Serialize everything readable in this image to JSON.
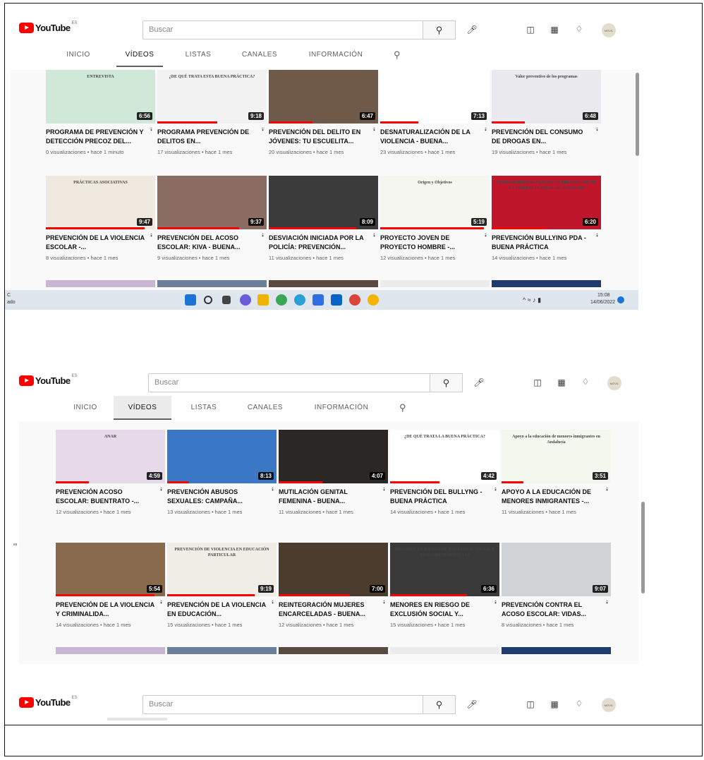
{
  "header": {
    "logo_text": "YouTube",
    "region": "ES",
    "search_placeholder": "Buscar",
    "avatar_text": "MÓVIL"
  },
  "tabs": [
    {
      "label": "INICIO"
    },
    {
      "label": "VÍDEOS"
    },
    {
      "label": "LISTAS"
    },
    {
      "label": "CANALES"
    },
    {
      "label": "INFORMACIÓN"
    }
  ],
  "shot1": {
    "videos": [
      {
        "title": "PROGRAMA DE PREVENCIÓN Y DETECCIÓN PRECOZ DEL...",
        "meta": "0 visualizaciones • hace 1 minuto",
        "duration": "6:56",
        "thumb_text": "ENTREVISTA",
        "bg": "#cfe8d8",
        "progress": 0
      },
      {
        "title": "PROGRAMA PREVENCIÓN DE DELITOS EN...",
        "meta": "17 visualizaciones • hace 1 mes",
        "duration": "9:18",
        "thumb_text": "¿DE QUÉ TRATA ESTA BUENA PRÁCTICA?",
        "bg": "#f2f2f2",
        "progress": 0.55
      },
      {
        "title": "PREVENCIÓN DEL DELITO EN JÓVENES: TU ESCUELITA...",
        "meta": "20 visualizaciones • hace 1 mes",
        "duration": "6:47",
        "thumb_text": "",
        "bg": "#6f5a4a",
        "progress": 0.4
      },
      {
        "title": "DESNATURALIZACIÓN DE LA VIOLENCIA - BUENA...",
        "meta": "23 visualizaciones • hace 1 mes",
        "duration": "7:13",
        "thumb_text": "",
        "bg": "#ffffff",
        "progress": 0.35
      },
      {
        "title": "PREVENCIÓN DEL CONSUMO DE DROGAS EN...",
        "meta": "19 visualizaciones • hace 1 mes",
        "duration": "6:48",
        "thumb_text": "Valor preventivo de los programas",
        "bg": "#e9e9ee",
        "progress": 0.3
      },
      {
        "title": "PREVENCIÓN DE LA VIOLENCIA ESCOLAR -...",
        "meta": "8 visualizaciones • hace 1 mes",
        "duration": "9:47",
        "thumb_text": "PRÁCTICAS ASOCIATIVAS",
        "bg": "#efe9df",
        "progress": 0.9
      },
      {
        "title": "PREVENCIÓN DEL ACOSO ESCOLAR: KIVA - BUENA...",
        "meta": "9 visualizaciones • hace 1 mes",
        "duration": "9:37",
        "thumb_text": "",
        "bg": "#8a6d60",
        "progress": 0.75
      },
      {
        "title": "DESVIACIÓN INICIADA POR LA POLICÍA: PREVENCIÓN...",
        "meta": "11 visualizaciones • hace 1 mes",
        "duration": "8:09",
        "thumb_text": "",
        "bg": "#3b3b3b",
        "progress": 0.8
      },
      {
        "title": "PROYECTO JOVEN DE PROYECTO HOMBRE -...",
        "meta": "12 visualizaciones • hace 1 mes",
        "duration": "5:19",
        "thumb_text": "Origen y Objetivos",
        "bg": "#f6f6f0",
        "progress": 0.95
      },
      {
        "title": "PREVENCIÓN BULLYING PDA - BUENA PRÁCTICA",
        "meta": "14 visualizaciones • hace 1 mes",
        "duration": "6:20",
        "thumb_text": "TRABAJO BUENAS PRÁCTICAS PREVENCIÓN DE LA VIOLENCIA ESCOLAR BULLYING",
        "bg": "#c0162c",
        "progress": 0.5
      }
    ],
    "taskbar": {
      "time": "15:08",
      "date": "14/06/2022",
      "left_text": "ado"
    }
  },
  "shot2": {
    "videos": [
      {
        "title": "PREVENCIÓN ACOSO ESCOLAR: BUENTRATO -...",
        "meta": "12 visualizaciones • hace 1 mes",
        "duration": "4:59",
        "thumb_text": "ANAR",
        "bg": "#e8d9ea",
        "progress": 0.3
      },
      {
        "title": "PREVENCIÓN ABUSOS SEXUALES: CAMPAÑA...",
        "meta": "13 visualizaciones • hace 1 mes",
        "duration": "8:13",
        "thumb_text": "",
        "bg": "#3a77c4",
        "progress": 0.2
      },
      {
        "title": "MUTILACIÓN GENITAL FEMENINA - BUENA...",
        "meta": "11 visualizaciones • hace 1 mes",
        "duration": "4:07",
        "thumb_text": "",
        "bg": "#2a2724",
        "progress": 0.4
      },
      {
        "title": "PREVENCIÓN DEL BULLYNG - BUENA PRÁCTICA",
        "meta": "14 visualizaciones • hace 1 mes",
        "duration": "4:42",
        "thumb_text": "¿DE QUÉ TRATA LA BUENA PRÁCTICA?",
        "bg": "#ffffff",
        "progress": 0.45
      },
      {
        "title": "APOYO A LA EDUCACIÓN DE MENORES INMIGRANTES -...",
        "meta": "11 visualizaciones • hace 1 mes",
        "duration": "3:51",
        "thumb_text": "Apoyo a la educación de menores inmigrantes en Andalucía",
        "bg": "#f4f7ee",
        "progress": 0.2
      },
      {
        "title": "PREVENCIÓN DE LA VIOLENCIA Y CRIMINALIDA...",
        "meta": "14 visualizaciones • hace 1 mes",
        "duration": "5:54",
        "thumb_text": "",
        "bg": "#8a6a4c",
        "progress": 0.9
      },
      {
        "title": "PREVENCIÓN DE LA VIOLENCIA EN EDUCACIÓN...",
        "meta": "15 visualizaciones • hace 1 mes",
        "duration": "9:19",
        "thumb_text": "PREVENCIÓN DE VIOLENCIA EN EDUCACIÓN PARTICULAR",
        "bg": "#f0ede6",
        "progress": 0.8
      },
      {
        "title": "REINTEGRACIÓN MUJERES ENCARCELADAS - BUENA...",
        "meta": "12 visualizaciones • hace 1 mes",
        "duration": "7:00",
        "thumb_text": "",
        "bg": "#4b3c2e",
        "progress": 0.65
      },
      {
        "title": "MENORES EN RIESGO DE EXCLUSIÓN SOCIAL Y...",
        "meta": "15 visualizaciones • hace 1 mes",
        "duration": "6:36",
        "thumb_text": "MENORES EN RIESGO DE EXCLUSIÓN SOCIAL Y DROGODEPENDENCIAS",
        "bg": "#3a3a3a",
        "progress": 0.7
      },
      {
        "title": "PREVENCIÓN CONTRA EL ACOSO ESCOLAR: VIDAS...",
        "meta": "8 visualizaciones • hace 1 mes",
        "duration": "9:07",
        "thumb_text": "",
        "bg": "#cfd3d6",
        "progress": 0
      }
    ]
  },
  "colors": {
    "brand": "#ff0000",
    "progress": "#ff0000",
    "page_bg": "#f9f9f9"
  }
}
